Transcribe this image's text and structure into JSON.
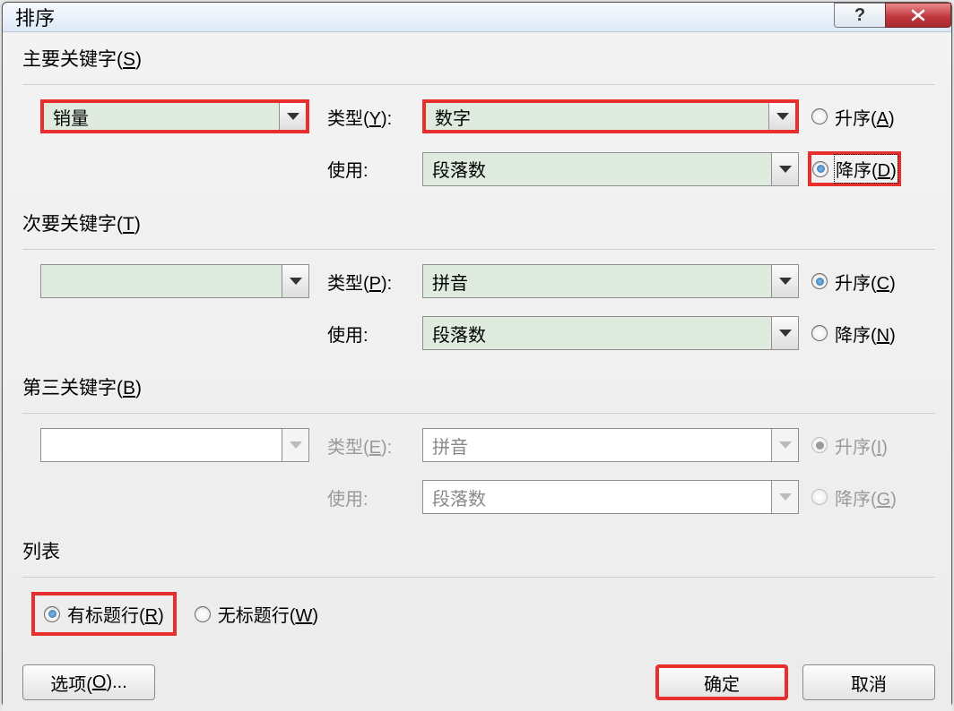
{
  "dialog": {
    "title": "排序"
  },
  "primary": {
    "group_label_pre": "主要关键字(",
    "group_label_key": "S",
    "group_label_post": ")",
    "key_value": "销量",
    "type_label_pre": "类型(",
    "type_label_key": "Y",
    "type_label_post": "):",
    "type_value": "数字",
    "use_label": "使用:",
    "use_value": "段落数",
    "asc_pre": "升序(",
    "asc_key": "A",
    "asc_post": ")",
    "desc_pre": "降序(",
    "desc_key": "D",
    "desc_post": ")"
  },
  "secondary": {
    "group_label_pre": "次要关键字(",
    "group_label_key": "T",
    "group_label_post": ")",
    "key_value": "",
    "type_label_pre": "类型(",
    "type_label_key": "P",
    "type_label_post": "):",
    "type_value": "拼音",
    "use_label": "使用:",
    "use_value": "段落数",
    "asc_pre": "升序(",
    "asc_key": "C",
    "asc_post": ")",
    "desc_pre": "降序(",
    "desc_key": "N",
    "desc_post": ")"
  },
  "tertiary": {
    "group_label_pre": "第三关键字(",
    "group_label_key": "B",
    "group_label_post": ")",
    "key_value": "",
    "type_label_pre": "类型(",
    "type_label_key": "E",
    "type_label_post": "):",
    "type_value": "拼音",
    "use_label": "使用:",
    "use_value": "段落数",
    "asc_pre": "升序(",
    "asc_key": "I",
    "asc_post": ")",
    "desc_pre": "降序(",
    "desc_key": "G",
    "desc_post": ")"
  },
  "list": {
    "group_label": "列表",
    "has_header_pre": "有标题行(",
    "has_header_key": "R",
    "has_header_post": ")",
    "no_header_pre": "无标题行(",
    "no_header_key": "W",
    "no_header_post": ")"
  },
  "buttons": {
    "options_pre": "选项(",
    "options_key": "O",
    "options_post": ")...",
    "ok": "确定",
    "cancel": "取消"
  }
}
